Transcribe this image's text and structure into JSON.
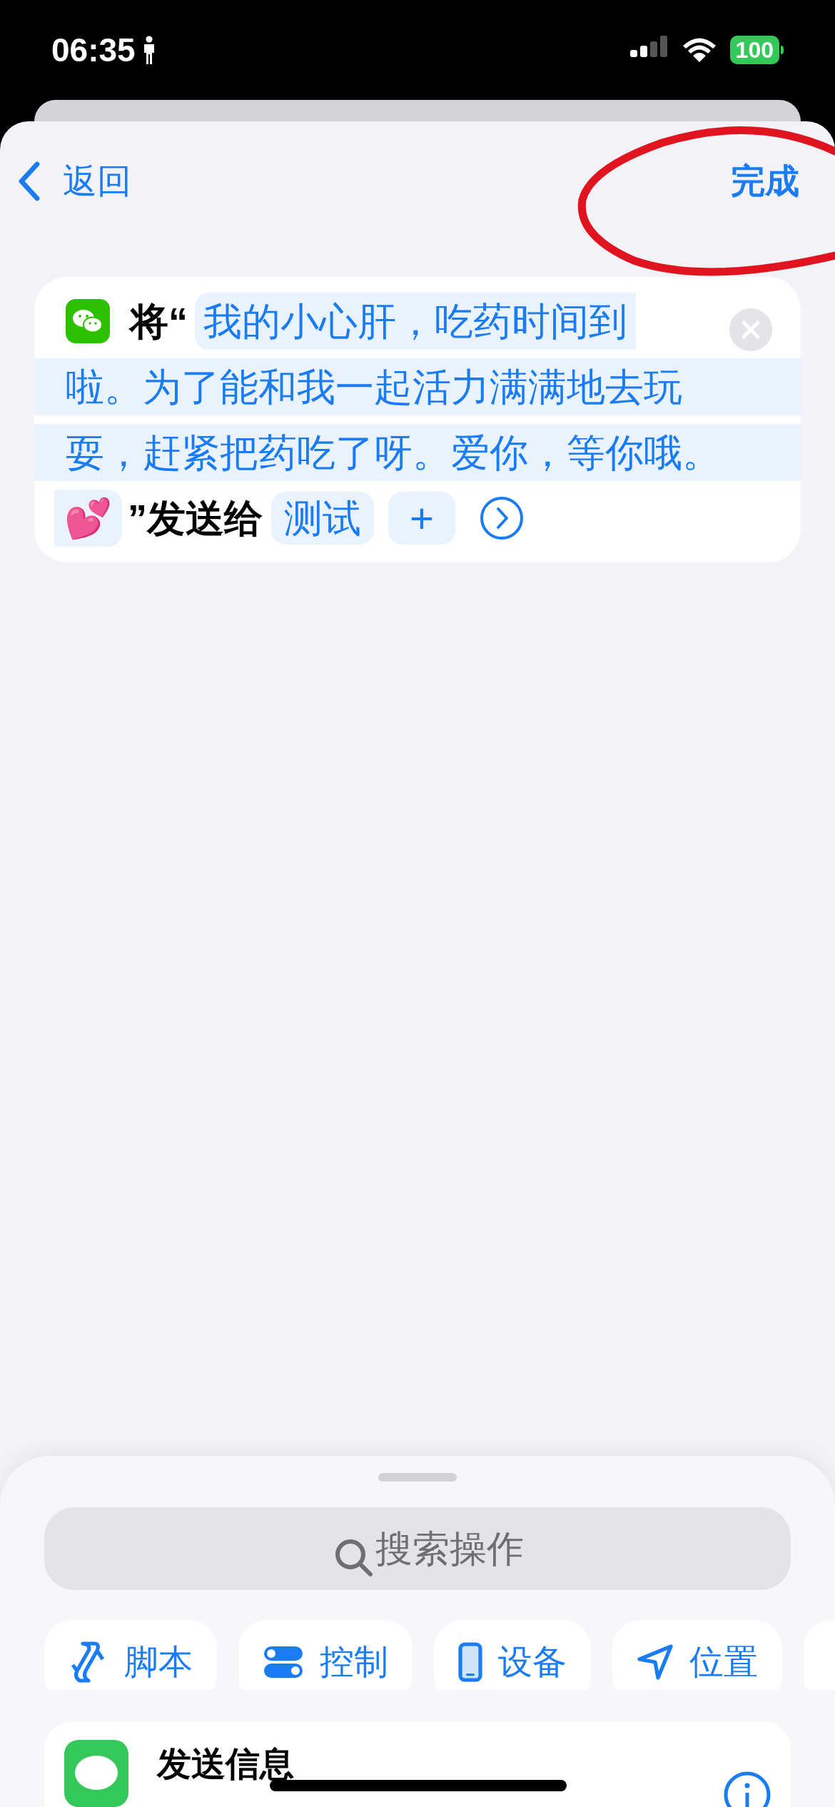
{
  "status_bar": {
    "time": "06:35",
    "battery": "100"
  },
  "nav": {
    "back": "返回",
    "done": "完成"
  },
  "action": {
    "prefix": "将“",
    "message_lines": [
      "我的小心肝，吃药时间到",
      "啦。为了能和我一起活力满满地去玩",
      "耍，赶紧把药吃了呀。爱你，等你哦。"
    ],
    "emoji": "💕",
    "suffix": "”发送给",
    "recipient": "测试",
    "add": "+"
  },
  "search": {
    "placeholder": "搜索操作"
  },
  "categories": [
    {
      "label": "脚本",
      "kind": "script"
    },
    {
      "label": "控制",
      "kind": "control"
    },
    {
      "label": "设备",
      "kind": "device"
    },
    {
      "label": "位置",
      "kind": "location"
    }
  ],
  "suggestion": {
    "title": "发送信息"
  }
}
